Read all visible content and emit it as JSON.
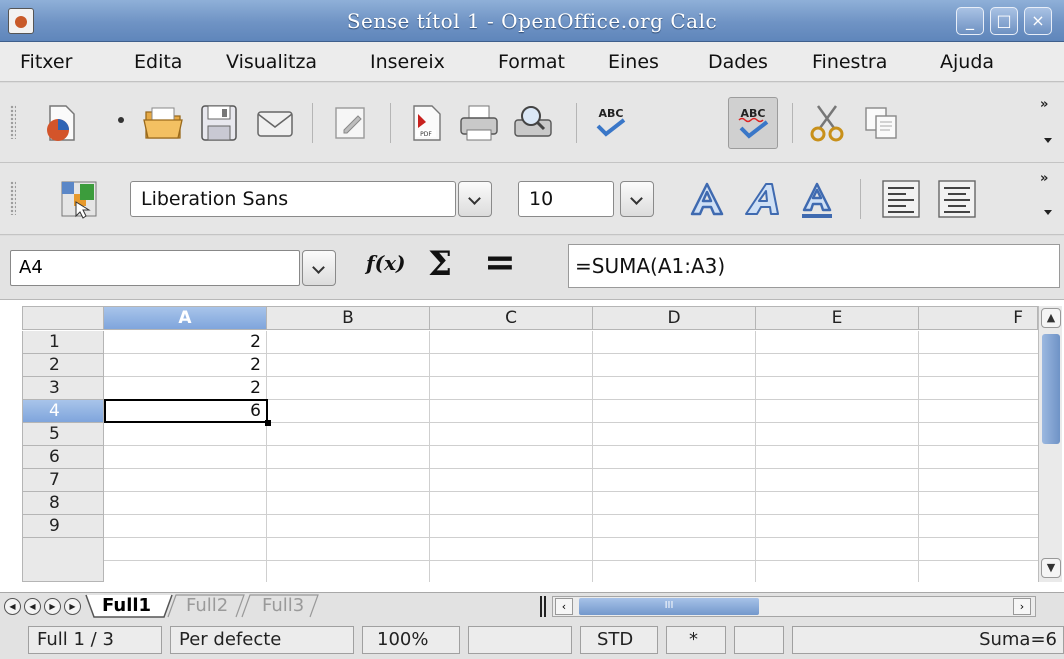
{
  "window": {
    "title": "Sense títol 1 - OpenOffice.org Calc",
    "minimize_label": "_",
    "maximize_label": "□",
    "close_label": "×"
  },
  "menubar": {
    "items": [
      "Fitxer",
      "Edita",
      "Visualitza",
      "Insereix",
      "Format",
      "Eines",
      "Dades",
      "Finestra",
      "Ajuda"
    ]
  },
  "toolbar": {
    "buttons": [
      "new-document",
      "open-folder",
      "save",
      "email",
      "edit-file",
      "export-pdf",
      "print",
      "print-preview",
      "spellcheck",
      "autospellcheck",
      "cut",
      "copy"
    ],
    "more_label": "»",
    "autospellcheck_active": true
  },
  "formatting": {
    "font_name": "Liberation Sans",
    "font_size": "10",
    "more_label": "»"
  },
  "formula_bar": {
    "name_box": "A4",
    "fx_label": "f(x)",
    "sigma_label": "Σ",
    "equals_label": "=",
    "formula": "=SUMA(A1:A3)"
  },
  "grid": {
    "columns": [
      "A",
      "B",
      "C",
      "D",
      "E",
      "F"
    ],
    "selected_column": "A",
    "rows": [
      "1",
      "2",
      "3",
      "4",
      "5",
      "6",
      "7",
      "8",
      "9"
    ],
    "selected_row": "4",
    "cells": {
      "A1": "2",
      "A2": "2",
      "A3": "2",
      "A4": "6"
    }
  },
  "sheets": {
    "tabs": [
      "Full1",
      "Full2",
      "Full3"
    ],
    "active": "Full1",
    "scroll_mark": "III"
  },
  "statusbar": {
    "sheet_position": "Full 1 / 3",
    "page_style": "Per defecte",
    "zoom": "100%",
    "selection_mode": "STD",
    "modified": "*",
    "sum": "Suma=6"
  },
  "colors": {
    "titlebar": "#6f93c4",
    "selection_header": "#7fa5dc"
  }
}
